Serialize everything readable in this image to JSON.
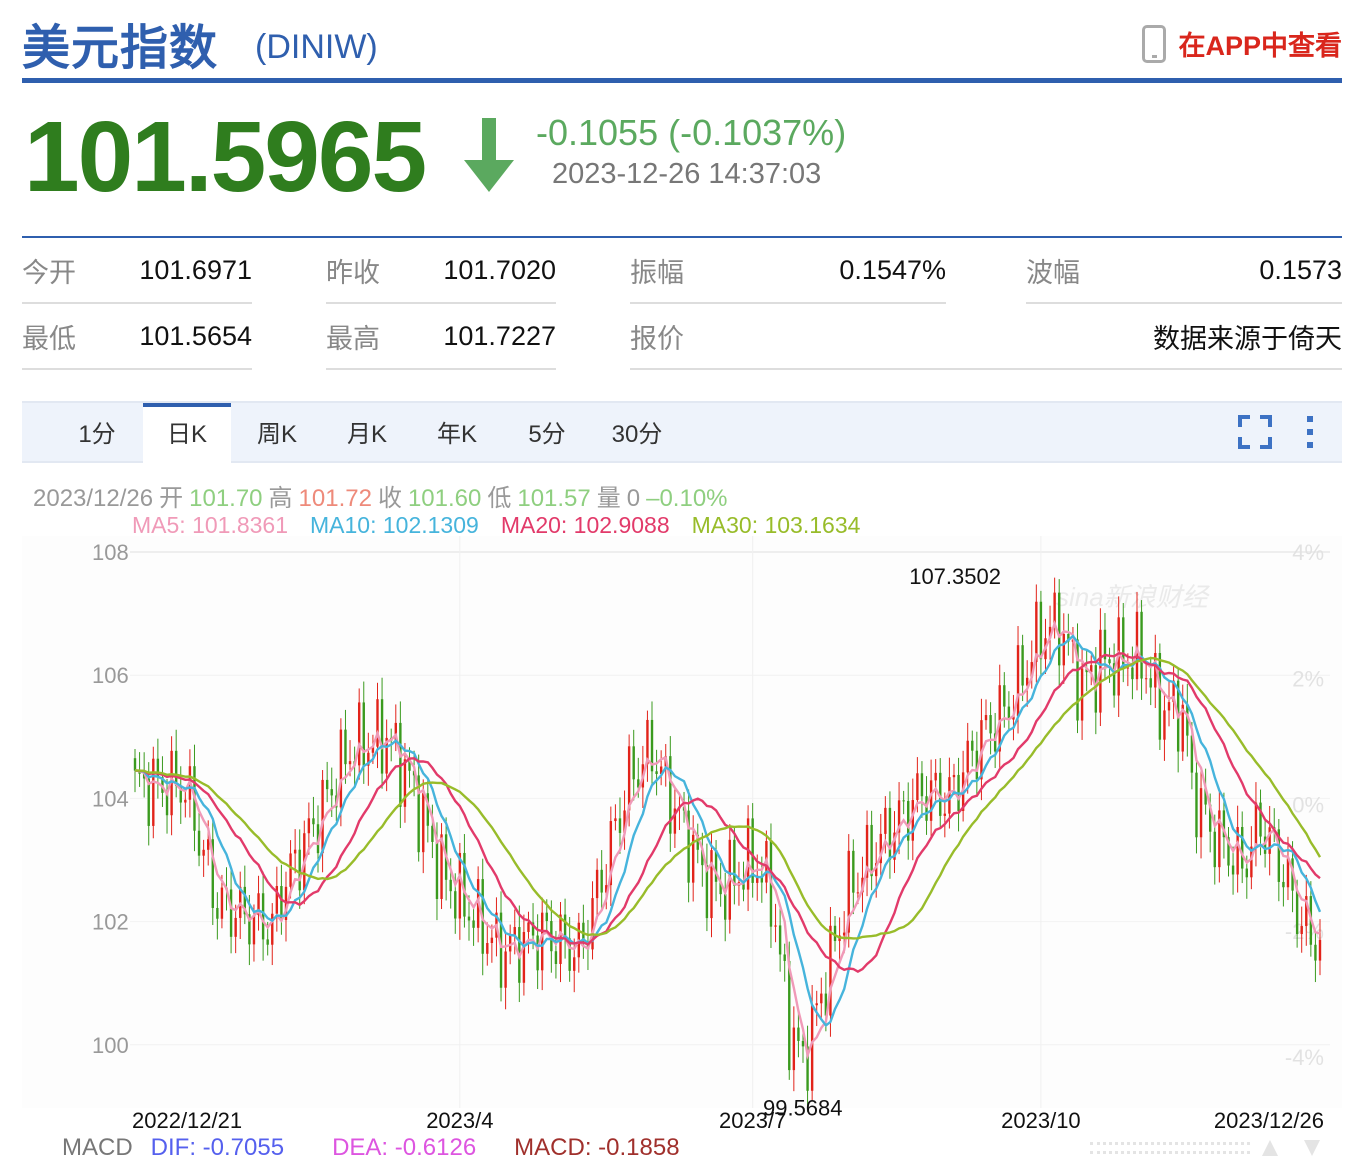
{
  "header": {
    "title": "美元指数",
    "code": "(DINIW)",
    "app_link": "在APP中查看"
  },
  "quote": {
    "price": "101.5965",
    "change": "-0.1055 (-0.1037%)",
    "time": "2023-12-26 14:37:03",
    "direction": "down"
  },
  "stats": [
    {
      "label": "今开",
      "value": "101.6971"
    },
    {
      "label": "昨收",
      "value": "101.7020"
    },
    {
      "label": "振幅",
      "value": "0.1547%"
    },
    {
      "label": "波幅",
      "value": "0.1573"
    },
    {
      "label": "最低",
      "value": "101.5654"
    },
    {
      "label": "最高",
      "value": "101.7227"
    },
    {
      "label": "报价",
      "value": ""
    },
    {
      "label": "",
      "value": "数据来源于倚天"
    }
  ],
  "tabs": [
    {
      "label": "1分"
    },
    {
      "label": "日K",
      "active": true
    },
    {
      "label": "周K"
    },
    {
      "label": "月K"
    },
    {
      "label": "年K"
    },
    {
      "label": "5分"
    },
    {
      "label": "30分"
    }
  ],
  "ohlc": {
    "date": "2023/12/26",
    "open_label": "开",
    "open": "101.70",
    "high_label": "高",
    "high": "101.72",
    "close_label": "收",
    "close": "101.60",
    "low_label": "低",
    "low": "101.57",
    "vol_label": "量",
    "vol": "0",
    "pct": "–0.10%"
  },
  "ma": {
    "ma5": "MA5: 101.8361",
    "ma10": "MA10: 102.1309",
    "ma20": "MA20: 102.9088",
    "ma30": "MA30: 103.1634"
  },
  "macd": {
    "label": "MACD",
    "dif": "DIF: -0.7055",
    "dea": "DEA: -0.6126",
    "macd": "MACD: -0.1858"
  },
  "colors": {
    "up": "#e2231a",
    "down": "#3a9a1e",
    "ma5": "#f09ab8",
    "ma10": "#46b4dc",
    "ma20": "#e23a6a",
    "ma30": "#98bc2a",
    "brand": "#2f5fae"
  },
  "chart_data": {
    "type": "candlestick",
    "ylim": [
      99.2,
      108.2
    ],
    "yticks": [
      100,
      102,
      104,
      106,
      108
    ],
    "right_ticks": [
      "4%",
      "2%",
      "0%",
      "-2%",
      "-4%"
    ],
    "right_tick_values": [
      4,
      2,
      0,
      -2,
      -4
    ],
    "base": 101.702,
    "xtick_labels": [
      "2022/12/21",
      "2023/4",
      "2023/7",
      "2023/10",
      "2023/12/26"
    ],
    "xtick_index": [
      0,
      71,
      135,
      198,
      259
    ],
    "n": 260,
    "close_waypoints": [
      [
        0,
        104.2
      ],
      [
        11,
        104.2
      ],
      [
        18,
        102.3
      ],
      [
        30,
        101.9
      ],
      [
        32,
        102.5
      ],
      [
        40,
        103.7
      ],
      [
        47,
        104.8
      ],
      [
        55,
        105.0
      ],
      [
        60,
        104.3
      ],
      [
        67,
        102.8
      ],
      [
        73,
        102.2
      ],
      [
        80,
        101.5
      ],
      [
        89,
        101.8
      ],
      [
        97,
        101.5
      ],
      [
        102,
        102.7
      ],
      [
        108,
        104.3
      ],
      [
        113,
        104.8
      ],
      [
        117,
        104.0
      ],
      [
        124,
        102.8
      ],
      [
        128,
        102.5
      ],
      [
        135,
        103.0
      ],
      [
        139,
        102.5
      ],
      [
        143,
        100.3
      ],
      [
        146,
        99.7
      ],
      [
        150,
        100.8
      ],
      [
        156,
        102.5
      ],
      [
        163,
        103.3
      ],
      [
        172,
        104.1
      ],
      [
        178,
        104.0
      ],
      [
        185,
        105.0
      ],
      [
        191,
        105.5
      ],
      [
        198,
        106.7
      ],
      [
        202,
        106.8
      ],
      [
        207,
        105.8
      ],
      [
        211,
        106.2
      ],
      [
        220,
        106.3
      ],
      [
        224,
        105.5
      ],
      [
        229,
        105.4
      ],
      [
        231,
        104.2
      ],
      [
        235,
        103.5
      ],
      [
        242,
        102.9
      ],
      [
        246,
        103.6
      ],
      [
        250,
        103.0
      ],
      [
        255,
        102.0
      ],
      [
        259,
        101.6
      ]
    ],
    "annotations": [
      {
        "label": "107.3502",
        "index": 202,
        "value": 107.3502
      },
      {
        "label": "99.5684",
        "index": 146,
        "value": 99.5684
      }
    ],
    "series": [
      "MA5",
      "MA10",
      "MA20",
      "MA30"
    ],
    "watermark": "sina新浪财经"
  }
}
